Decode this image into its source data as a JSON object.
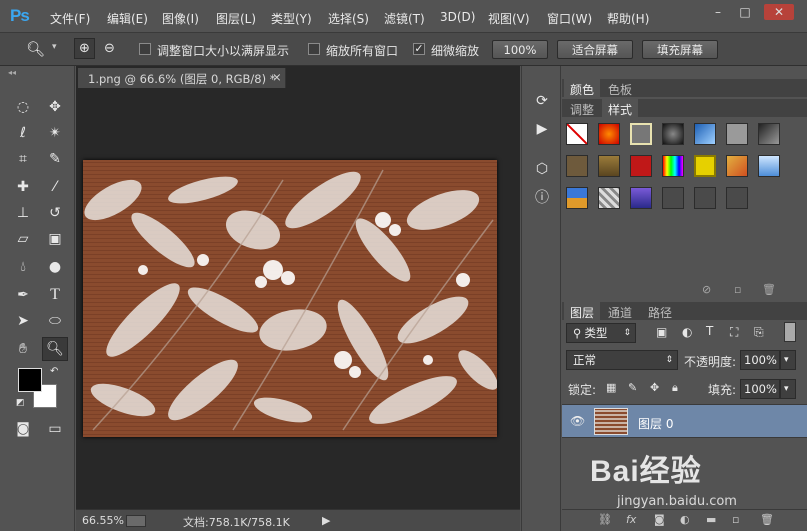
{
  "app": {
    "logo": "Ps"
  },
  "menu": [
    "文件(F)",
    "编辑(E)",
    "图像(I)",
    "图层(L)",
    "类型(Y)",
    "选择(S)",
    "滤镜(T)",
    "3D(D)",
    "视图(V)",
    "窗口(W)",
    "帮助(H)"
  ],
  "window_controls": {
    "minimize": "–",
    "restore": "□",
    "close": "✕"
  },
  "options": {
    "resize_windows": "调整窗口大小以满屏显示",
    "zoom_all": "缩放所有窗口",
    "scrubby_zoom": "细微缩放",
    "zoom_100": "100%",
    "fit_screen": "适合屏幕",
    "fill_screen": "填充屏幕"
  },
  "document": {
    "tab_title": "1.png @ 66.6% (图层 0, RGB/8) *",
    "close": "×"
  },
  "status": {
    "zoom": "66.55%",
    "doc_size": "文档:758.1K/758.1K",
    "arrow": "▶"
  },
  "panels": {
    "top_tabs": [
      "颜色",
      "色板"
    ],
    "mid_tabs": [
      "调整",
      "样式"
    ],
    "layers_tabs": [
      "图层",
      "通道",
      "路径"
    ],
    "filter_kind": "类型",
    "blend_mode": "正常",
    "opacity_label": "不透明度:",
    "opacity_value": "100%",
    "lock_label": "锁定:",
    "fill_label": "填充:",
    "fill_value": "100%",
    "layer_name": "图层 0"
  },
  "colors": {
    "layer_selected": "#6e87a8",
    "canvas_base": "#8a4b2e"
  },
  "watermark": {
    "brand": "Bai经验",
    "url": "jingyan.baidu.com"
  }
}
